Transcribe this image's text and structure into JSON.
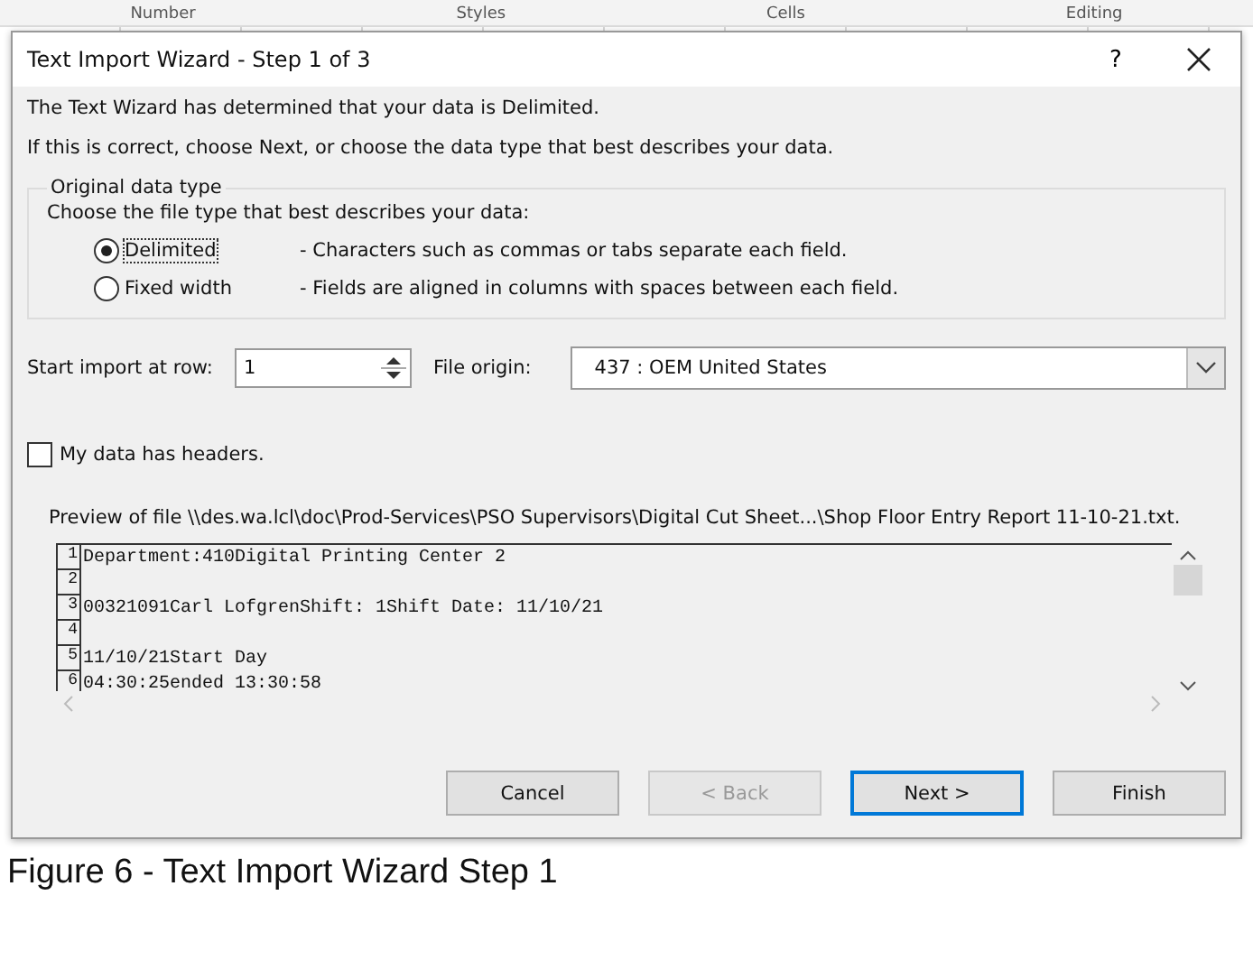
{
  "background_ribbon": [
    "Number",
    "Styles",
    "Cells",
    "Editing"
  ],
  "window": {
    "title": "Text Import Wizard - Step 1 of 3",
    "help": "?"
  },
  "intro": [
    "The Text Wizard has determined that your data is Delimited.",
    "If this is correct, choose Next, or choose the data type that best describes your data."
  ],
  "data_type": {
    "legend": "Original data type",
    "prompt": "Choose the file type that best describes your data:",
    "options": [
      {
        "label": "Delimited",
        "description": "- Characters such as commas or tabs separate each field.",
        "selected": true
      },
      {
        "label": "Fixed width",
        "description": "- Fields are aligned in columns with spaces between each field.",
        "selected": false
      }
    ]
  },
  "start_row": {
    "label": "Start import at row:",
    "value": "1"
  },
  "file_origin": {
    "label": "File origin:",
    "value": "437 : OEM United States"
  },
  "headers_checkbox": {
    "label": "My data has headers.",
    "checked": false
  },
  "preview": {
    "caption": "Preview of file \\\\des.wa.lcl\\doc\\Prod-Services\\PSO Supervisors\\Digital Cut Sheet...\\Shop Floor Entry Report 11-10-21.txt.",
    "lines": [
      {
        "number": "1",
        "text": "Department:410Digital Printing Center 2"
      },
      {
        "number": "2"
      },
      {
        "number": "3",
        "text": "00321091Carl LofgrenShift: 1Shift Date: 11/10/21"
      },
      {
        "number": "4"
      },
      {
        "number": "5",
        "text": "11/10/21Start Day"
      },
      {
        "number": "6",
        "text": "04:30:25ended 13:30:58"
      }
    ]
  },
  "buttons": [
    {
      "label": "Cancel",
      "disabled": false,
      "default": false
    },
    {
      "label": "< Back",
      "disabled": true,
      "default": false
    },
    {
      "label": "Next >",
      "disabled": false,
      "default": true
    },
    {
      "label": "Finish",
      "disabled": false,
      "default": false
    }
  ],
  "figure_caption": "Figure 6 - Text Import Wizard Step 1"
}
